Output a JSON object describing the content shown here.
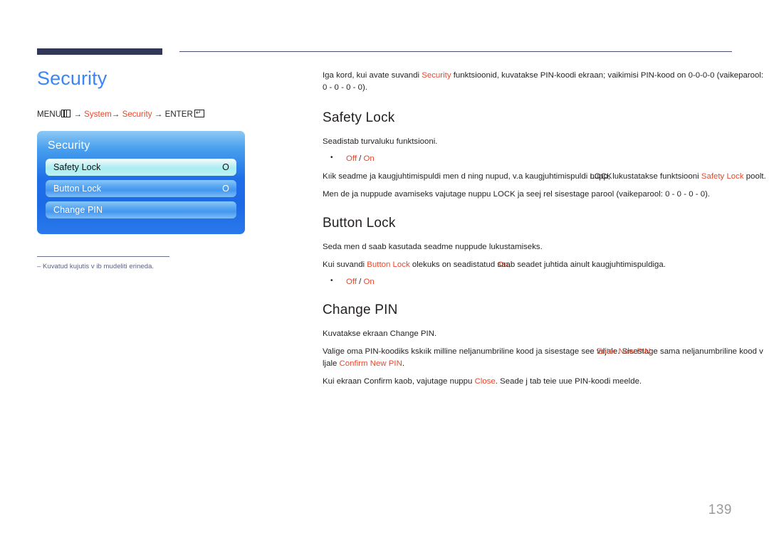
{
  "page": {
    "number": "139"
  },
  "left": {
    "title": "Security",
    "menu_path": {
      "menu_label": "MENU",
      "arrow1": "→",
      "system_label": "System",
      "arrow2": "→",
      "security_label": "Security",
      "arrow3": "→",
      "enter_label": "ENTER"
    },
    "osd": {
      "title": "Security",
      "rows": [
        {
          "label": "Safety Lock",
          "value": "O",
          "selected": true
        },
        {
          "label": "Button Lock",
          "value": "O",
          "selected": false
        },
        {
          "label": "Change PIN",
          "value": "",
          "selected": false
        }
      ]
    },
    "footnote": "–  Kuvatud kujutis v ib mudeliti erineda."
  },
  "right": {
    "intro": {
      "p1_a": "Iga kord, kui avate suvandi ",
      "p1_link": "Security",
      "p1_b": " funktsioonid, kuvatakse PIN-koodi ekraan; vaikimisi PIN-kood on 0-0-0-0 (vaikeparool: 0 - 0 - 0 - 0)."
    },
    "safety_lock": {
      "heading": "Safety Lock",
      "p1": "Seadistab turvaluku funktsiooni.",
      "options": [
        "Off",
        "/",
        "On"
      ],
      "p2_a": "Kıik seadme ja kaugjuhtimispuldi men  d ning nupud, v.a kaugjuhtimispuldi ",
      "p2_overlap_under": "nupp",
      "p2_overlap_over": "LOCK",
      "p2_b": ", lukustatakse funktsiooni ",
      "p2_link": "Safety Lock",
      "p2_c": " poolt.",
      "p3": "Men  de ja nuppude avamiseks vajutage nuppu LOCK ja seej rel sisestage parool (vaikeparool: 0 - 0 - 0 - 0)."
    },
    "button_lock": {
      "heading": "Button Lock",
      "p1": "Seda men  d saab kasutada seadme nuppude lukustamiseks.",
      "p2_a": "Kui suvandi ",
      "p2_link": "Button Lock",
      "p2_b": " olekuks on seadistatud ",
      "p2_overlap_under": "On,",
      "p2_overlap_over": "saa",
      "p2_c": "b seadet juhtida ainult kaugjuhtimispuldiga.",
      "options": [
        "Off",
        "/",
        "On"
      ]
    },
    "change_pin": {
      "heading": "Change PIN",
      "p1": "Kuvatakse ekraan Change PIN.",
      "p2_a": "Valige oma PIN-koodiks  kskıik milline neljanumbriline kood ja sisestage see ",
      "p2_overlap_under": "vıljale",
      "p2_overlap_over": "Enter New PIN",
      "p2_b": ". Sisestage sama neljanumbriline kood v ljale ",
      "p2_link": "Confirm New PIN",
      "p2_c": ".",
      "p3_a": "Kui ekraan Confirm kaob, vajutage nuppu ",
      "p3_link": "Close",
      "p3_b": ". Seade j tab teie uue PIN-koodi meelde."
    }
  }
}
